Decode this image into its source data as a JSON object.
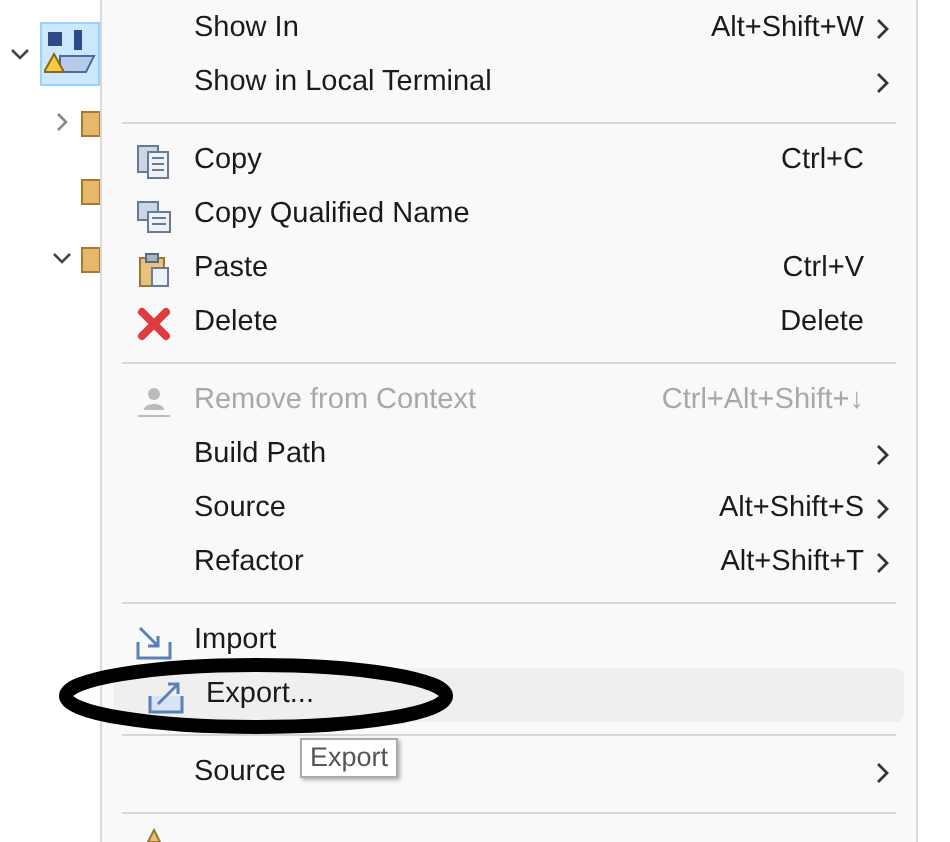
{
  "tree": [
    {
      "expanded": true,
      "selected": true,
      "children": [
        {
          "expanded": false,
          "leaf": false
        },
        {
          "leaf": true
        },
        {
          "expanded": true,
          "leaf": false
        }
      ]
    }
  ],
  "menu": [
    {
      "kind": "item",
      "label": "Show In",
      "shortcut": "Alt+Shift+W",
      "submenu": true,
      "disabled": false,
      "selected": false
    },
    {
      "kind": "item",
      "label": "Show in Local Terminal",
      "submenu": true,
      "disabled": false,
      "selected": false
    },
    {
      "kind": "separator"
    },
    {
      "kind": "item",
      "label": "Copy",
      "shortcut": "Ctrl+C",
      "submenu": false,
      "disabled": false,
      "selected": false
    },
    {
      "kind": "item",
      "label": "Copy Qualified Name",
      "submenu": false,
      "disabled": false,
      "selected": false
    },
    {
      "kind": "item",
      "label": "Paste",
      "shortcut": "Ctrl+V",
      "submenu": false,
      "disabled": false,
      "selected": false
    },
    {
      "kind": "item",
      "label": "Delete",
      "shortcut": "Delete",
      "submenu": false,
      "disabled": false,
      "selected": false
    },
    {
      "kind": "separator"
    },
    {
      "kind": "item",
      "label": "Remove from Context",
      "shortcut": "Ctrl+Alt+Shift+↓",
      "submenu": false,
      "disabled": true,
      "selected": false
    },
    {
      "kind": "item",
      "label": "Build Path",
      "submenu": true,
      "disabled": false,
      "selected": false
    },
    {
      "kind": "item",
      "label": "Source",
      "shortcut": "Alt+Shift+S",
      "submenu": true,
      "disabled": false,
      "selected": false
    },
    {
      "kind": "item",
      "label": "Refactor",
      "shortcut": "Alt+Shift+T",
      "submenu": true,
      "disabled": false,
      "selected": false
    },
    {
      "kind": "separator"
    },
    {
      "kind": "item",
      "label": "Import",
      "submenu": false,
      "disabled": false,
      "selected": false
    },
    {
      "kind": "item",
      "label": "Export...",
      "submenu": false,
      "disabled": false,
      "selected": true
    },
    {
      "kind": "separator"
    },
    {
      "kind": "item",
      "label": "Source",
      "submenu": true,
      "disabled": false,
      "selected": false
    },
    {
      "kind": "separator"
    },
    {
      "kind": "partial"
    }
  ],
  "tooltip": {
    "text": "Export"
  },
  "annotation": {
    "kind": "ellipse"
  }
}
